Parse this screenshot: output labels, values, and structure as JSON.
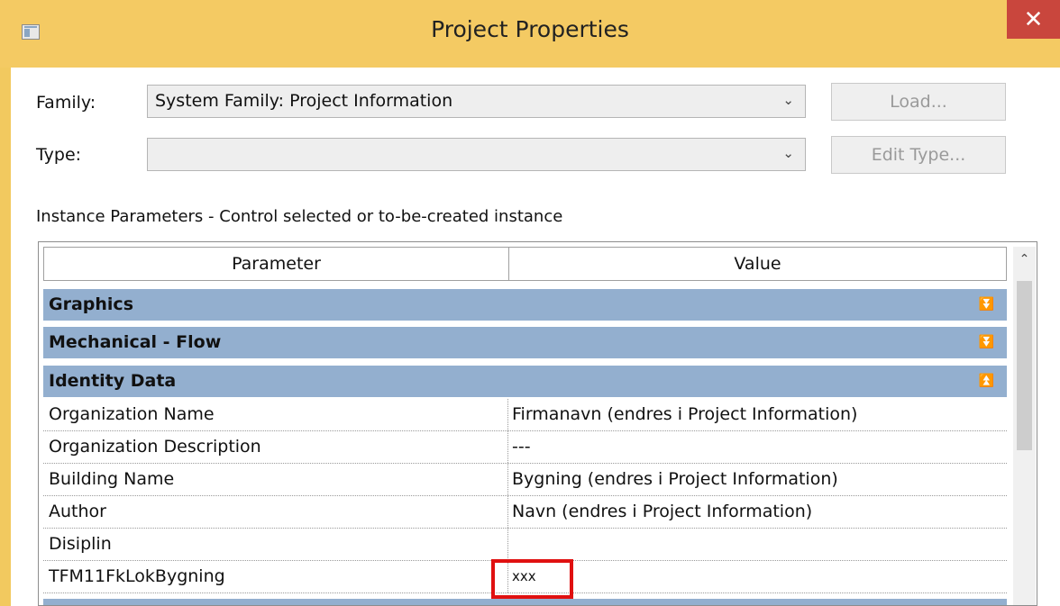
{
  "window": {
    "title": "Project Properties",
    "close_glyph": "✕",
    "icon": "app-window-icon"
  },
  "family": {
    "label": "Family:",
    "value": "System Family: Project Information",
    "load_button": "Load..."
  },
  "type": {
    "label": "Type:",
    "value": "",
    "edit_type_button": "Edit Type..."
  },
  "combo_arrow": "⌄",
  "instance_caption": "Instance Parameters - Control selected or to-be-created instance",
  "grid": {
    "headers": {
      "parameter": "Parameter",
      "value": "Value"
    },
    "groups": [
      {
        "label": "Graphics",
        "state": "collapsed",
        "chevron": "⏬"
      },
      {
        "label": "Mechanical - Flow",
        "state": "collapsed",
        "chevron": "⏬"
      },
      {
        "label": "Identity Data",
        "state": "expanded",
        "chevron": "⏫"
      }
    ],
    "rows": [
      {
        "parameter": "Organization Name",
        "value": "Firmanavn (endres i Project Information)"
      },
      {
        "parameter": "Organization Description",
        "value": "---"
      },
      {
        "parameter": "Building Name",
        "value": "Bygning (endres i Project Information)"
      },
      {
        "parameter": "Author",
        "value": "Navn (endres i Project Information)"
      },
      {
        "parameter": "Disiplin",
        "value": ""
      },
      {
        "parameter": "TFM11FkLokBygning",
        "value": "xxx"
      }
    ],
    "scroll_up_glyph": "⌃"
  },
  "colors": {
    "title_bar": "#f4ca63",
    "close_button": "#c9463d",
    "group_header": "#93afcf",
    "highlight": "#e01010"
  }
}
